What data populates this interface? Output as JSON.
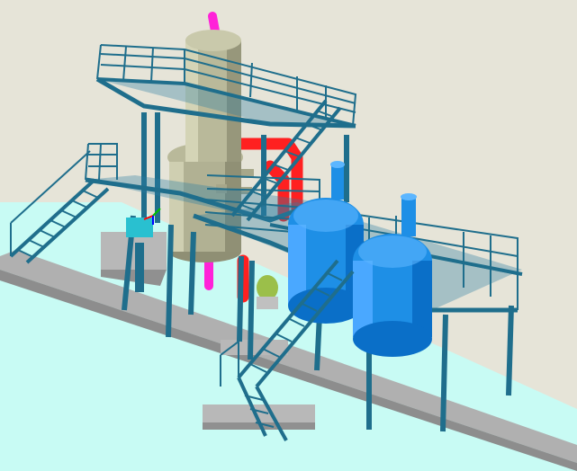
{
  "scene": {
    "description_visible_text": "",
    "colors": {
      "background": "#e6e4d8",
      "floor": "#c8fbf4",
      "foundation": "#b4b4b4",
      "foundation_dark": "#9a9a9a",
      "structure": "#1f6e8c",
      "structure_dark": "#0f4a63",
      "platform": "#2a7fa3",
      "column_vessel": "#b9b99a",
      "column_vessel_dark": "#8f8f74",
      "reactor": "#1e8fe6",
      "reactor_light": "#5cb6ff",
      "reactor_dark": "#0a5fb0",
      "pipe_red": "#ff2020",
      "pipe_magenta": "#ff22d8",
      "pump_green": "#9bbf4a"
    },
    "icons": [
      "axis-gizmo-icon"
    ]
  }
}
